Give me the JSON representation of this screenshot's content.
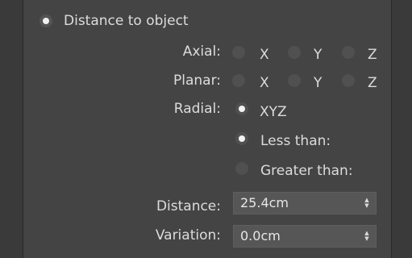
{
  "main_option": {
    "label": "Distance to object",
    "selected": true
  },
  "axial": {
    "label": "Axial:",
    "options": [
      "X",
      "Y",
      "Z"
    ]
  },
  "planar": {
    "label": "Planar:",
    "options": [
      "X",
      "Y",
      "Z"
    ]
  },
  "radial": {
    "label": "Radial:",
    "option": "XYZ"
  },
  "range": {
    "less_than": "Less than:",
    "greater_than": "Greater than:"
  },
  "distance": {
    "label": "Distance:",
    "value": "25.4cm"
  },
  "variation": {
    "label": "Variation:",
    "value": "0.0cm"
  },
  "icons": {
    "spinner": "spinner-arrows-icon"
  }
}
